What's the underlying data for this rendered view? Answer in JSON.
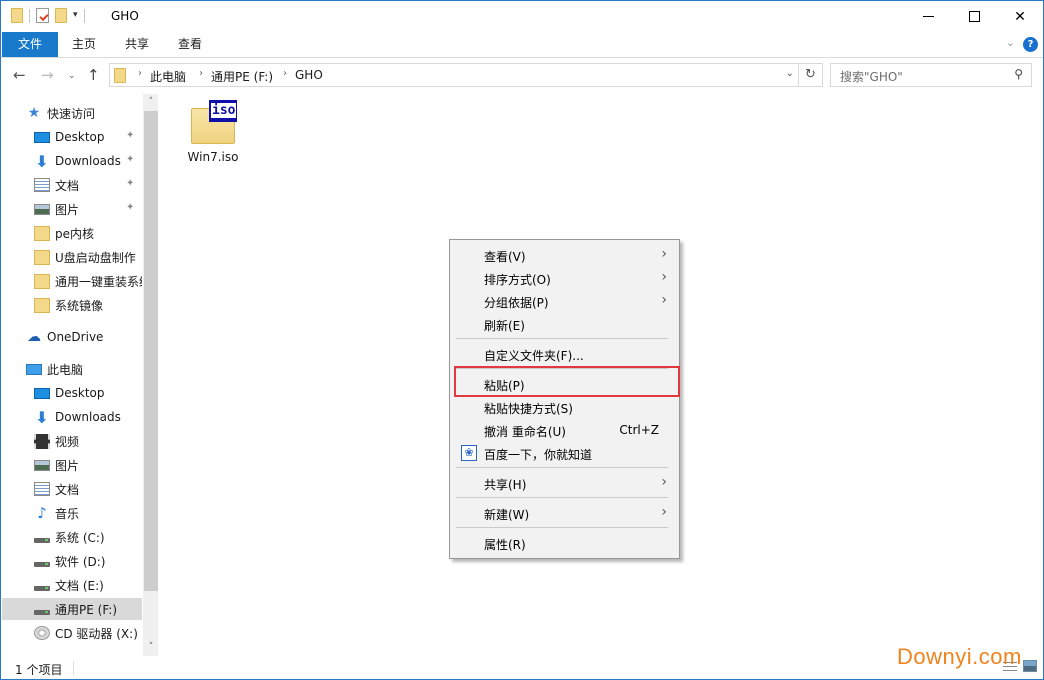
{
  "window": {
    "title": "GHO",
    "controls": {
      "minimize": "minimize",
      "maximize": "maximize",
      "close": "✕"
    }
  },
  "ribbon": {
    "tabs": [
      {
        "label": "文件",
        "active": true
      },
      {
        "label": "主页"
      },
      {
        "label": "共享"
      },
      {
        "label": "查看"
      }
    ],
    "help": "?",
    "expand": "⌄"
  },
  "nav": {
    "back": "←",
    "forward": "→",
    "recent": "⌄",
    "up": "↑",
    "breadcrumb": [
      "此电脑",
      "通用PE (F:)",
      "GHO"
    ],
    "separator": "›",
    "dropdown": "⌄",
    "refresh": "↻",
    "search_placeholder": "搜索\"GHO\"",
    "search_icon": "⚲"
  },
  "sidebar": {
    "quick_access": {
      "label": "快速访问",
      "icon": "star-icon"
    },
    "quick_items": [
      {
        "label": "Desktop",
        "icon": "desktop-icon",
        "pinned": true
      },
      {
        "label": "Downloads",
        "icon": "downloads-icon",
        "pinned": true
      },
      {
        "label": "文档",
        "icon": "document-icon",
        "pinned": true
      },
      {
        "label": "图片",
        "icon": "picture-icon",
        "pinned": true
      },
      {
        "label": "pe内核",
        "icon": "folder-icon"
      },
      {
        "label": "U盘启动盘制作",
        "icon": "folder-icon"
      },
      {
        "label": "通用一键重装系统",
        "icon": "folder-icon"
      },
      {
        "label": "系统镜像",
        "icon": "folder-icon"
      }
    ],
    "onedrive": {
      "label": "OneDrive",
      "icon": "cloud-icon"
    },
    "this_pc": {
      "label": "此电脑",
      "icon": "computer-icon"
    },
    "pc_items": [
      {
        "label": "Desktop",
        "icon": "desktop-icon"
      },
      {
        "label": "Downloads",
        "icon": "downloads-icon"
      },
      {
        "label": "视频",
        "icon": "video-icon"
      },
      {
        "label": "图片",
        "icon": "picture-icon"
      },
      {
        "label": "文档",
        "icon": "document-icon"
      },
      {
        "label": "音乐",
        "icon": "music-icon"
      },
      {
        "label": "系统 (C:)",
        "icon": "drive-icon"
      },
      {
        "label": "软件 (D:)",
        "icon": "drive-icon"
      },
      {
        "label": "文档 (E:)",
        "icon": "drive-icon"
      },
      {
        "label": "通用PE (F:)",
        "icon": "drive-icon",
        "selected": true
      },
      {
        "label": "CD 驱动器 (X:)",
        "icon": "cd-drive-icon"
      }
    ],
    "pin_glyph": "📌",
    "scroll_up": "˄",
    "scroll_down": "˅"
  },
  "content": {
    "files": [
      {
        "name": "Win7.iso",
        "badge": "iso"
      }
    ]
  },
  "context_menu": {
    "items": [
      {
        "label": "查看(V)",
        "submenu": true
      },
      {
        "label": "排序方式(O)",
        "submenu": true
      },
      {
        "label": "分组依据(P)",
        "submenu": true
      },
      {
        "label": "刷新(E)"
      },
      {
        "separator": true
      },
      {
        "label": "自定义文件夹(F)..."
      },
      {
        "separator": true
      },
      {
        "label": "粘贴(P)",
        "highlighted": true
      },
      {
        "label": "粘贴快捷方式(S)"
      },
      {
        "label": "撤消 重命名(U)",
        "shortcut": "Ctrl+Z"
      },
      {
        "label": "百度一下，你就知道",
        "icon": "baidu-paw-icon"
      },
      {
        "separator": true
      },
      {
        "label": "共享(H)",
        "submenu": true
      },
      {
        "separator": true
      },
      {
        "label": "新建(W)",
        "submenu": true
      },
      {
        "separator": true
      },
      {
        "label": "属性(R)"
      }
    ],
    "arrow_glyph": "›",
    "paw_glyph": "🐾",
    "highlight_color": "#e0393e"
  },
  "status": {
    "item_count": "1 个项目"
  },
  "watermark": "Downyi.com",
  "colors": {
    "accent": "#1979ca",
    "selection": "#d9d9d9",
    "watermark": "#f0831e"
  }
}
